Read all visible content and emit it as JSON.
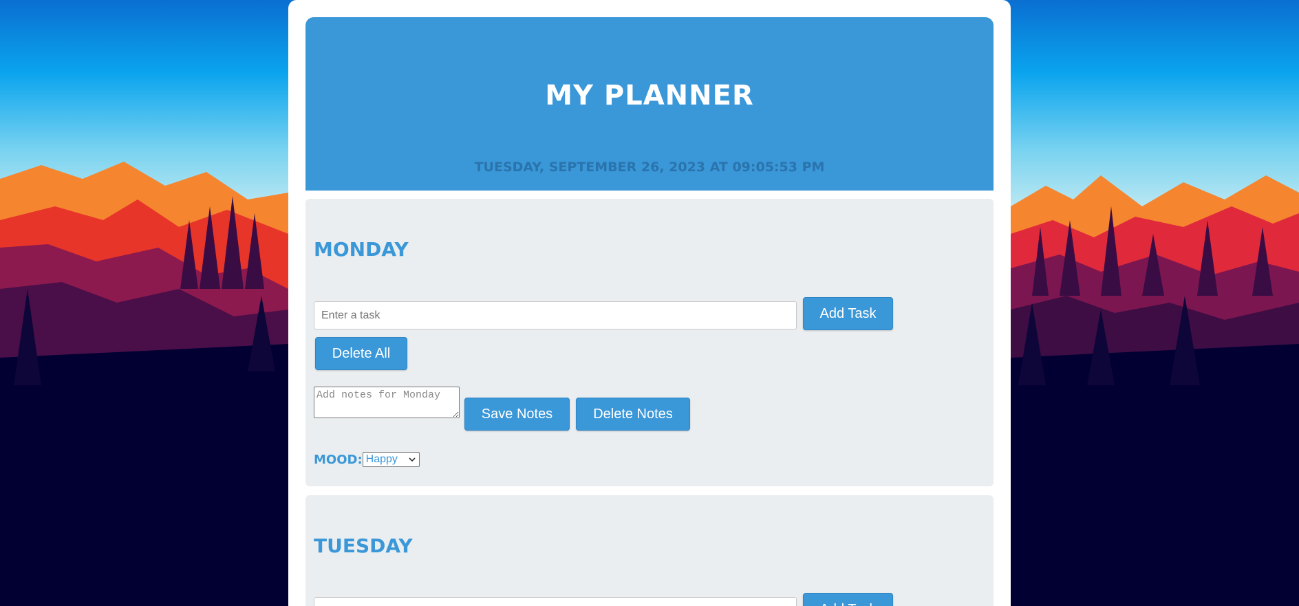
{
  "header": {
    "title": "My Planner",
    "datetime": "Tuesday, September 26, 2023 at 09:05:53 PM"
  },
  "days": [
    {
      "name": "Monday",
      "task_placeholder": "Enter a task",
      "add_task_label": "Add Task",
      "delete_all_label": "Delete All",
      "notes_placeholder": "Add notes for Monday",
      "save_notes_label": "Save Notes",
      "delete_notes_label": "Delete Notes",
      "mood_label": "Mood:",
      "mood_value": "Happy"
    },
    {
      "name": "Tuesday",
      "task_placeholder": "",
      "add_task_label": "Add Task"
    }
  ],
  "colors": {
    "accent": "#3a97d8",
    "panel": "#eaeef0",
    "card": "#ffffff"
  },
  "icons": {
    "mood_select": "chevron-down-icon"
  }
}
